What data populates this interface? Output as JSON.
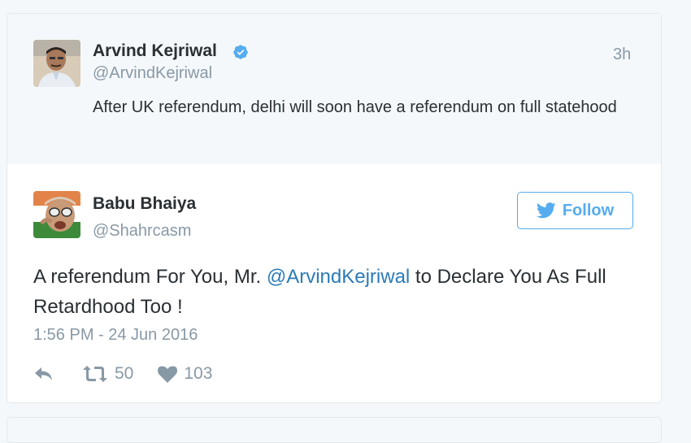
{
  "parent_tweet": {
    "author_name": "Arvind Kejriwal",
    "author_handle": "@ArvindKejriwal",
    "time": "3h",
    "text": "After UK referendum, delhi will soon have a referendum on full statehood"
  },
  "main_tweet": {
    "author_name": "Babu Bhaiya",
    "author_handle": "@Shahrcasm",
    "follow_label": "Follow",
    "text_before": "A referendum For You, Mr. ",
    "mention": "@ArvindKejriwal",
    "text_after": " to Declare You As Full Retardhood Too !",
    "timestamp": "1:56 PM - 24 Jun 2016",
    "retweets": "50",
    "likes": "103"
  },
  "colors": {
    "accent": "#55acee",
    "link": "#2b7bb9",
    "muted": "#8899a6",
    "text": "#292f33",
    "parent_bg": "#f5f8fa"
  },
  "icons": [
    "verified-badge-icon",
    "twitter-bird-icon",
    "reply-icon",
    "retweet-icon",
    "heart-icon"
  ]
}
